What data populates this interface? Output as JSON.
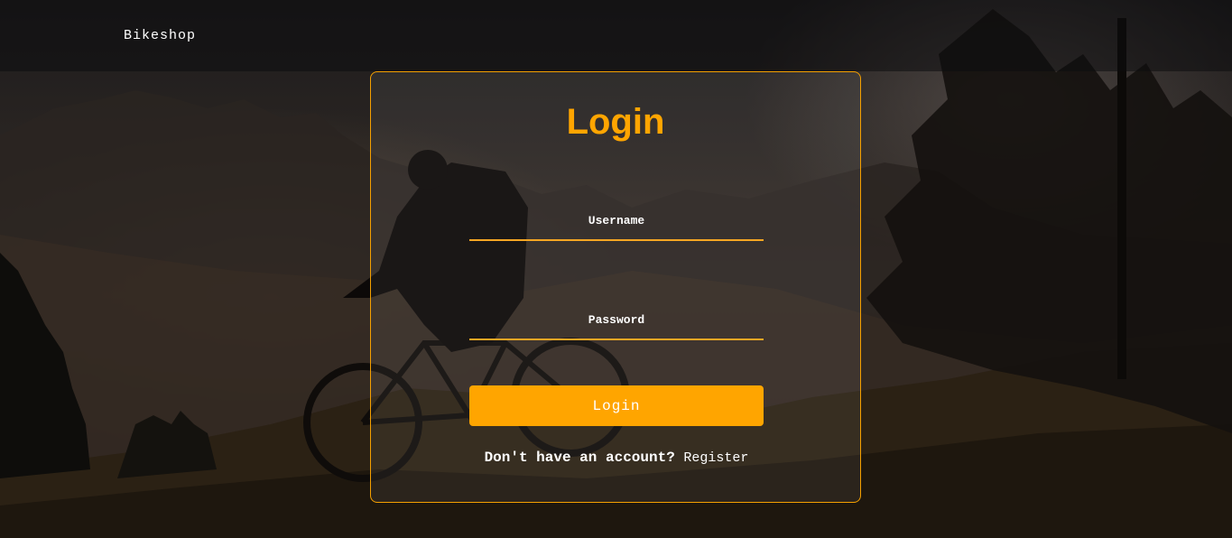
{
  "navbar": {
    "brand": "Bikeshop"
  },
  "login_form": {
    "title": "Login",
    "username_placeholder": "Username",
    "password_placeholder": "Password",
    "submit_label": "Login",
    "register_prompt": "Don't have an account?",
    "register_link": "Register"
  },
  "colors": {
    "accent": "#ffa500",
    "text": "#ffffff"
  }
}
